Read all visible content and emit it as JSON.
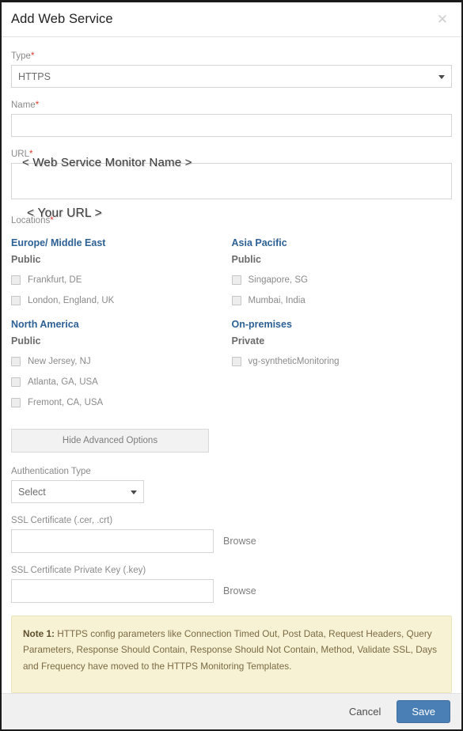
{
  "dialog": {
    "title": "Add Web Service",
    "close_icon": "close-icon"
  },
  "form": {
    "type": {
      "label": "Type",
      "required_mark": "*",
      "value": "HTTPS",
      "caret_icon": "chevron-down-icon"
    },
    "name": {
      "label": "Name",
      "required_mark": "*",
      "value": "",
      "annotation": "< Web Service Monitor Name >"
    },
    "url": {
      "label": "URL",
      "required_mark": "*",
      "value": "",
      "annotation": "< Your URL >"
    },
    "locations": {
      "label": "Locations",
      "required_mark": "*",
      "columns": [
        {
          "regions": [
            {
              "region": "Europe/ Middle East",
              "visibility": "Public",
              "items": [
                {
                  "label": "Frankfurt, DE",
                  "checked": false
                },
                {
                  "label": "London, England, UK",
                  "checked": false
                }
              ]
            },
            {
              "region": "North America",
              "visibility": "Public",
              "items": [
                {
                  "label": "New Jersey, NJ",
                  "checked": false
                },
                {
                  "label": "Atlanta, GA, USA",
                  "checked": false
                },
                {
                  "label": "Fremont, CA, USA",
                  "checked": false
                }
              ]
            }
          ]
        },
        {
          "regions": [
            {
              "region": "Asia Pacific",
              "visibility": "Public",
              "items": [
                {
                  "label": "Singapore, SG",
                  "checked": false
                },
                {
                  "label": "Mumbai, India",
                  "checked": false
                }
              ]
            },
            {
              "region": "On-premises",
              "visibility": "Private",
              "items": [
                {
                  "label": "vg-syntheticMonitoring",
                  "checked": false
                }
              ]
            }
          ]
        }
      ]
    },
    "advanced_toggle": "Hide Advanced Options",
    "auth_type": {
      "label": "Authentication Type",
      "value": "Select",
      "caret_icon": "chevron-down-icon"
    },
    "ssl_certificate": {
      "label": "SSL Certificate (.cer, .crt)",
      "value": "",
      "browse_label": "Browse"
    },
    "ssl_private_key": {
      "label": "SSL Certificate Private Key (.key)",
      "value": "",
      "browse_label": "Browse"
    }
  },
  "note": {
    "lead": "Note 1:",
    "body": " HTTPS config parameters like Connection Timed Out, Post Data, Request Headers, Query Parameters, Response Should Contain, Response Should Not Contain, Method, Validate SSL, Days and Frequency have moved to the HTTPS Monitoring Templates."
  },
  "footer": {
    "cancel_label": "Cancel",
    "save_label": "Save"
  },
  "colors": {
    "region_heading": "#2d6095",
    "required_mark": "#e03c31",
    "save_button": "#4a7fb5",
    "note_background": "#f7f2d3"
  }
}
